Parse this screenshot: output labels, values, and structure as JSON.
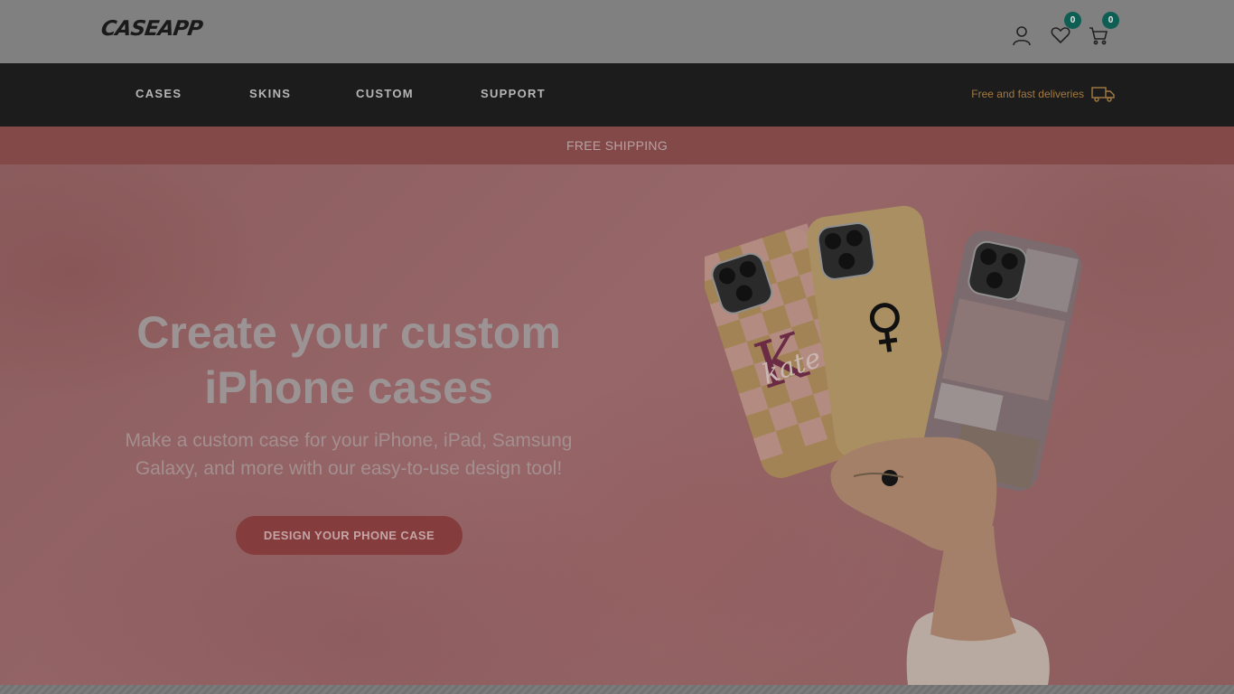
{
  "header": {
    "logo_text": "CASEAPP",
    "wishlist_count": "0",
    "cart_count": "0"
  },
  "nav": {
    "items": [
      {
        "label": "CASES"
      },
      {
        "label": "SKINS"
      },
      {
        "label": "CUSTOM"
      },
      {
        "label": "SUPPORT"
      }
    ],
    "delivery_text": "Free and fast deliveries"
  },
  "promo": {
    "text": "FREE SHIPPING"
  },
  "hero": {
    "title_line1": "Create your custom",
    "title_line2": "iPhone cases",
    "subtitle_line1": "Make a custom case for your iPhone, iPad, Samsung",
    "subtitle_line2": "Galaxy, and more with our easy-to-use design tool!",
    "cta_label": "DESIGN YOUR PHONE CASE",
    "case_monogram": "K",
    "case_script": "kate"
  },
  "icons": {
    "account": "user-icon",
    "wishlist": "heart-icon",
    "cart": "cart-icon",
    "delivery": "truck-icon"
  },
  "colors": {
    "nav_bg": "#1c1c1c",
    "promo_bg": "#834848",
    "badge": "#0f5e54",
    "cta_bg": "#843c3d",
    "delivery_text": "#a37a42"
  }
}
